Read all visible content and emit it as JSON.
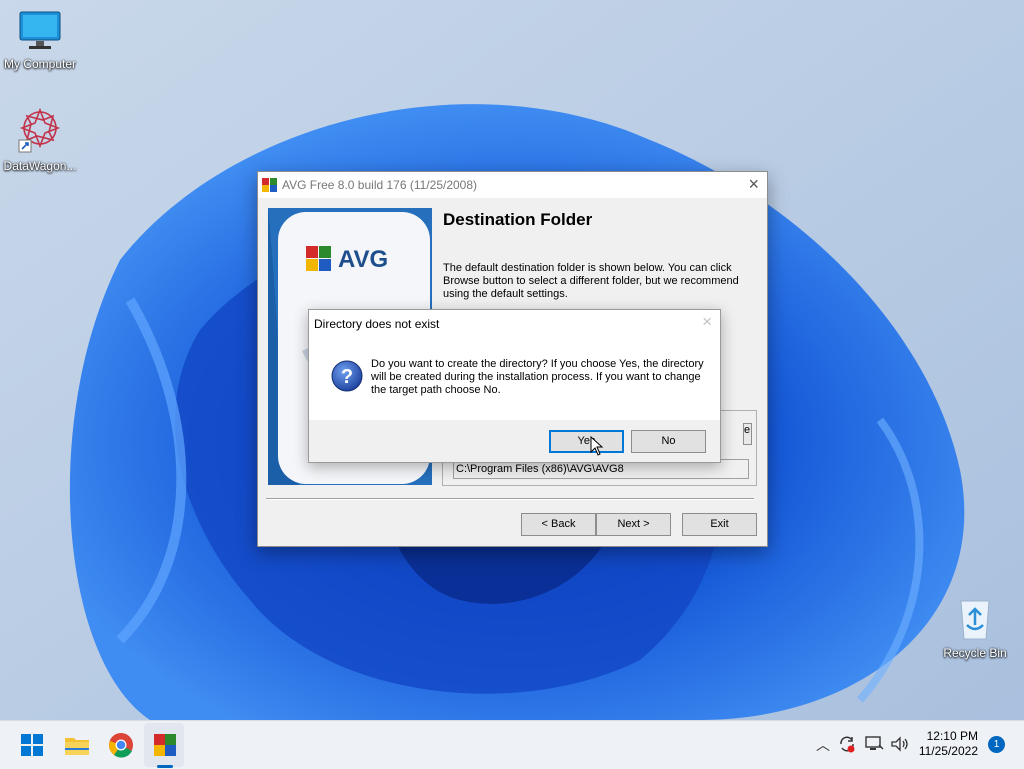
{
  "desktop": {
    "icons": [
      {
        "label": "My Computer"
      },
      {
        "label": "DataWagon..."
      },
      {
        "label": "Recycle Bin"
      }
    ]
  },
  "installer": {
    "title": "AVG Free 8.0 build 176 (11/25/2008)",
    "banner_logo_text": "AVG",
    "heading": "Destination Folder",
    "description": "The default destination folder is shown below. You can click Browse button to select a different folder, but we recommend using the default settings.",
    "browse_label": "e",
    "path_value": "C:\\Program Files (x86)\\AVG\\AVG8",
    "back_label": "< Back",
    "next_label": "Next >",
    "exit_label": "Exit"
  },
  "dialog": {
    "title": "Directory does not exist",
    "message": "Do you want to create the directory? If you choose Yes, the directory will be created during the installation process. If you want to change the target path choose No.",
    "yes_label": "Yes",
    "no_label": "No"
  },
  "taskbar": {
    "apps": [
      "start-icon",
      "file-explorer-icon",
      "chrome-icon",
      "avg-installer-icon"
    ],
    "time": "12:10 PM",
    "date": "11/25/2022",
    "notification_count": "1"
  },
  "colors": {
    "accent": "#0078d7",
    "wallpaper_blue": "#1a6ee8",
    "avg_banner": "#1a5fa8"
  }
}
